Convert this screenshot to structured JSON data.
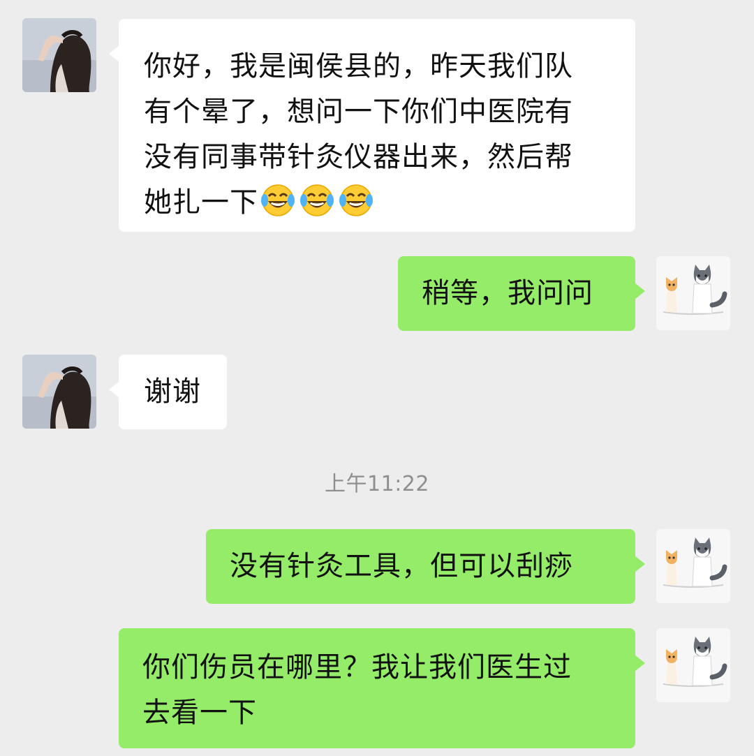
{
  "chat": {
    "timestamp": "上午11:22",
    "messages": [
      {
        "sender": "other",
        "lines": [
          "你好，我是闽侯县的，昨天我们队",
          "有个晕了，想问一下你们中医院有",
          "没有同事带针灸仪器出来，然后帮",
          "她扎一下"
        ],
        "emoji": [
          "laughing-with-tears",
          "laughing-with-tears",
          "laughing-with-tears"
        ]
      },
      {
        "sender": "self",
        "text": "稍等，我问问"
      },
      {
        "sender": "other",
        "text": "谢谢"
      },
      {
        "sender": "self",
        "text": "没有针灸工具，但可以刮痧"
      },
      {
        "sender": "self",
        "lines": [
          "你们伤员在哪里？我让我们医生过",
          "去看一下"
        ]
      }
    ]
  },
  "colors": {
    "background": "#ededed",
    "incoming_bubble": "#ffffff",
    "outgoing_bubble": "#95ec69",
    "text": "#111111",
    "timestamp": "#8f8f8f"
  },
  "icons": {
    "other_avatar": "woman-avatar",
    "self_avatar": "cat-and-husky-avatar",
    "emoji": "laughing-with-tears-emoji"
  }
}
